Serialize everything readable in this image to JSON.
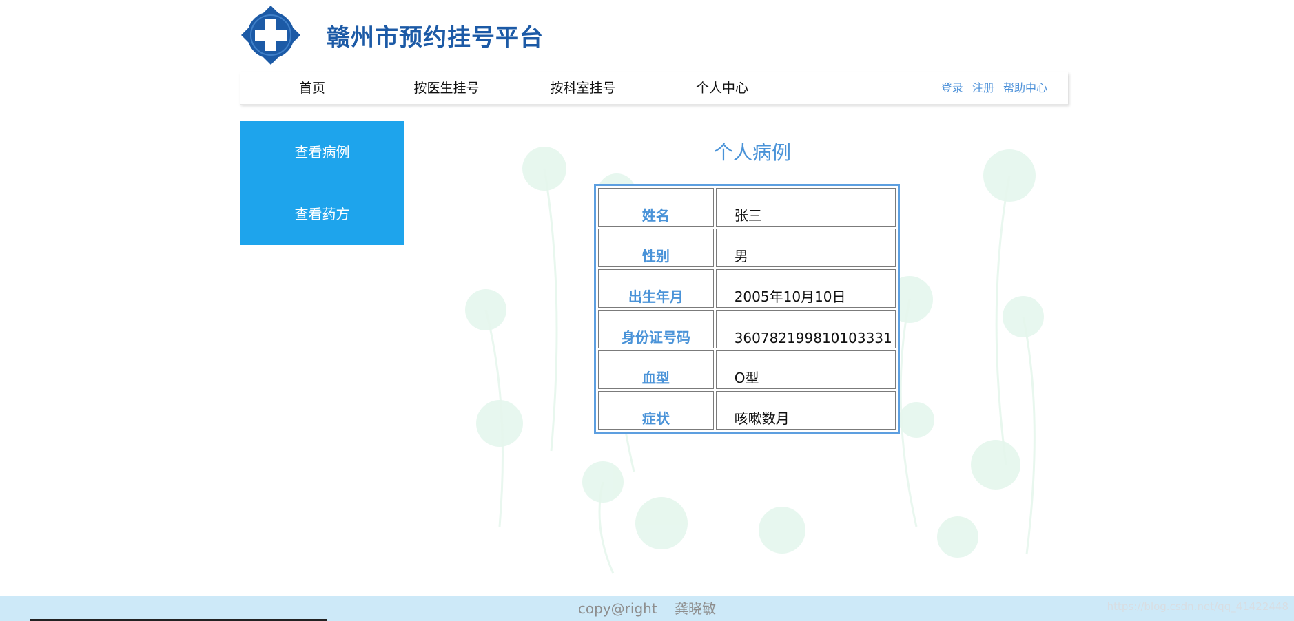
{
  "header": {
    "title": "赣州市预约挂号平台"
  },
  "nav": {
    "items": [
      "首页",
      "按医生挂号",
      "按科室挂号",
      "个人中心"
    ],
    "links": [
      "登录",
      "注册",
      "帮助中心"
    ]
  },
  "sidebar": {
    "items": [
      "查看病例",
      "查看药方"
    ]
  },
  "main": {
    "heading": "个人病例",
    "rows": [
      {
        "label": "姓名",
        "value": "张三"
      },
      {
        "label": "性别",
        "value": "男"
      },
      {
        "label": "出生年月",
        "value": "2005年10月10日"
      },
      {
        "label": "身份证号码",
        "value": "360782199810103331"
      },
      {
        "label": "血型",
        "value": "O型"
      },
      {
        "label": "症状",
        "value": "咳嗽数月"
      }
    ]
  },
  "footer": {
    "copyright": "copy@right    龚晓敏",
    "watermark": "https://blog.csdn.net/qq_41422448"
  },
  "colors": {
    "brand_blue": "#1c5aa6",
    "sidebar_blue": "#1ea4ec",
    "accent_blue": "#4a93d8",
    "footer_bg": "#cde9f8"
  },
  "icons": {
    "logo": "medical-cross-logo-icon"
  }
}
